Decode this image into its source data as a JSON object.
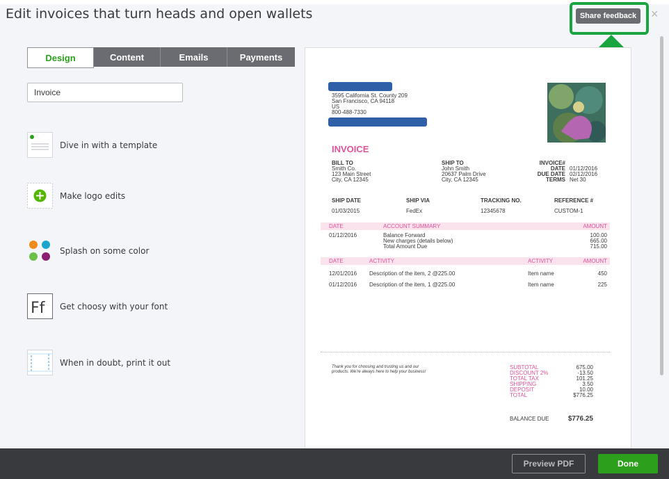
{
  "header": {
    "title": "Edit invoices that turn heads and open wallets",
    "share_feedback": "Share feedback",
    "close": "×"
  },
  "tabs": [
    {
      "label": "Design",
      "active": true
    },
    {
      "label": "Content",
      "active": false
    },
    {
      "label": "Emails",
      "active": false
    },
    {
      "label": "Payments",
      "active": false
    }
  ],
  "invoice_name_value": "Invoice",
  "side_items": [
    {
      "label": "Dive in with a template",
      "icon": "template-icon"
    },
    {
      "label": "Make logo edits",
      "icon": "logo-add-icon"
    },
    {
      "label": "Splash on some color",
      "icon": "color-palette-icon"
    },
    {
      "label": "Get choosy with your font",
      "icon": "font-icon"
    },
    {
      "label": "When in doubt, print it out",
      "icon": "print-margins-icon"
    }
  ],
  "preview": {
    "address": [
      "3595 California St. County 209",
      "San Francisco, CA 94118",
      "US",
      "800-488-7330"
    ],
    "doc_title": "INVOICE",
    "bill_to": {
      "label": "BILL TO",
      "lines": [
        "Smith Co.",
        "123 Main Street",
        "City, CA 12345"
      ]
    },
    "ship_to": {
      "label": "SHIP TO",
      "lines": [
        "John Smith",
        "20637 Palm Drive",
        "City, CA 12345"
      ]
    },
    "meta": {
      "labels": [
        "INVOICE#",
        "DATE",
        "DUE DATE",
        "TERMS"
      ],
      "values": [
        "",
        "01/12/2016",
        "02/12/2016",
        "Net 30"
      ]
    },
    "ship_row": {
      "headers": [
        "SHIP DATE",
        "SHIP VIA",
        "TRACKING NO.",
        "REFERENCE #"
      ],
      "values": [
        "01/03/2015",
        "FedEx",
        "12345678",
        "CUSTOM-1"
      ]
    },
    "summary": {
      "headers": [
        "DATE",
        "ACCOUNT SUMMARY",
        "AMOUNT"
      ],
      "date": "01/12/2016",
      "lines": [
        "Balance Forward",
        "New charges (details below)",
        "Total Amount Due"
      ],
      "amounts": [
        "100.00",
        "665.00",
        "715.00"
      ]
    },
    "activity": {
      "headers": [
        "DATE",
        "ACTIVITY",
        "ACTIVITY",
        "AMOUNT"
      ],
      "rows": [
        {
          "date": "12/01/2016",
          "desc": "Description of the item, 2 @225.00",
          "item": "Item name",
          "amount": "450"
        },
        {
          "date": "01/12/2016",
          "desc": "Description of the item, 1 @225.00",
          "item": "Item name",
          "amount": "225"
        }
      ]
    },
    "thanks": [
      "Thank you for choosing and trusting us and our",
      "products. We're always here to help your business!"
    ],
    "totals": {
      "labels": [
        "SUBTOTAL",
        "DISCOUNT 2%",
        "TOTAL TAX",
        "SHIPPING",
        "DEPOSIT",
        "TOTAL"
      ],
      "values": [
        "675.00",
        "-13.50",
        "101.25",
        "3.50",
        "10.00",
        "$776.25"
      ]
    },
    "balance_due_label": "BALANCE DUE",
    "balance_due_value": "$776.25"
  },
  "footer": {
    "preview_pdf": "Preview PDF",
    "done": "Done"
  },
  "colors": {
    "accent_green": "#2ca01c",
    "invoice_pink": "#e0539a",
    "highlight_green": "#19a641",
    "redaction_blue": "#2e5fa7"
  }
}
